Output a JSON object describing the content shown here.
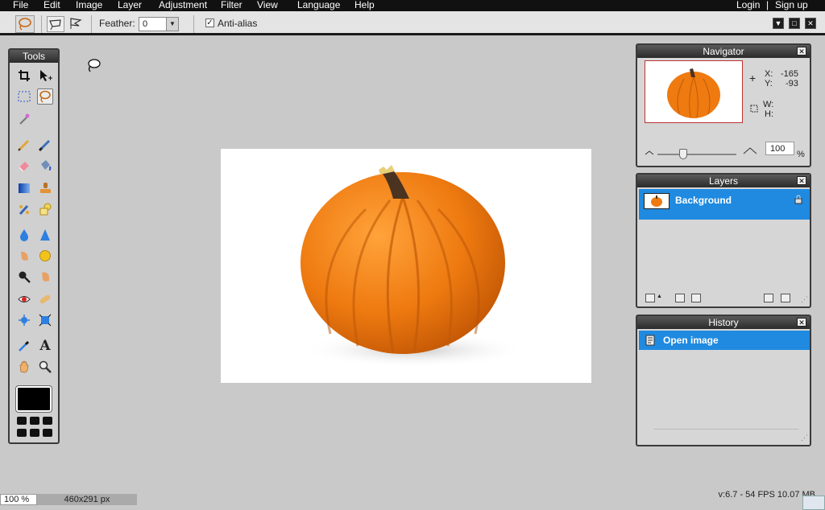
{
  "menu": {
    "items": [
      "File",
      "Edit",
      "Image",
      "Layer",
      "Adjustment",
      "Filter",
      "View",
      "Language",
      "Help"
    ],
    "login": "Login",
    "separator": "|",
    "signup": "Sign up"
  },
  "toolbar": {
    "feather_label": "Feather:",
    "feather_value": "0",
    "antialias_label": "Anti-alias",
    "antialias_checked": true
  },
  "tools_panel": {
    "title": "Tools",
    "selected_tool": "lasso-tool",
    "foreground_color": "#000000"
  },
  "navigator": {
    "title": "Navigator",
    "x_label": "X:",
    "x_value": "-165",
    "y_label": "Y:",
    "y_value": "-93",
    "w_label": "W:",
    "h_label": "H:",
    "zoom_value": "100",
    "zoom_unit": "%",
    "zoom_level": 0.31
  },
  "layers": {
    "title": "Layers",
    "items": [
      {
        "name": "Background",
        "locked": true,
        "selected": true
      }
    ]
  },
  "history": {
    "title": "History",
    "items": [
      {
        "name": "Open image",
        "selected": true
      }
    ]
  },
  "status": {
    "zoom": "100 %",
    "dimensions": "460x291 px",
    "version": "v:6.7 - 54 FPS 10.07 MB"
  },
  "colors": {
    "accent": "#1f8ae0",
    "menubar": "#111111",
    "panel_title": "#2a2a2a",
    "workspace": "#c9c9c9"
  }
}
